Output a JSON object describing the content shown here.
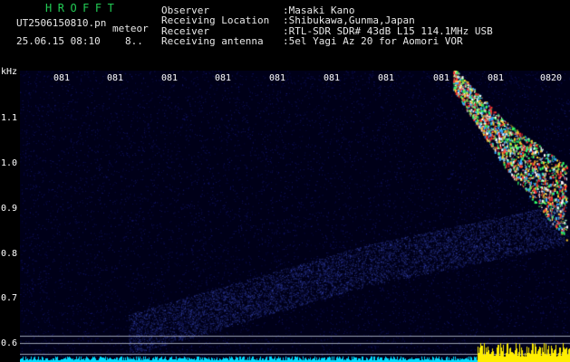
{
  "header": {
    "station_code": "HROFFT",
    "file_name": "UT2506150810.pn",
    "event_type": "meteor",
    "date_time": "25.06.15 08:10",
    "event_count": "8.."
  },
  "info": [
    {
      "key": "Observer",
      "value": ":Masaki Kano"
    },
    {
      "key": "Receiving Location",
      "value": ":Shibukawa,Gunma,Japan"
    },
    {
      "key": "Receiver",
      "value": ":RTL-SDR SDR# 43dB L15 114.1MHz USB"
    },
    {
      "key": "Receiving antenna",
      "value": ":5el Yagi Az 20 for Aomori VOR"
    }
  ],
  "spectrogram": {
    "y_unit": "kHz",
    "y_ticks": [
      "1.1",
      "1.0",
      "0.9",
      "0.8",
      "0.7",
      "0.6"
    ],
    "x_ticks": [
      "081",
      "081",
      "081",
      "081",
      "081",
      "081",
      "081",
      "081",
      "081",
      "0820"
    ],
    "colors": {
      "background": "#000018",
      "noise": "#2233aa",
      "echo_hot": "#ff3333",
      "echo_mid": "#33ff66",
      "echo_cool": "#33aaff",
      "baseline_level": "#00ddff",
      "signal_level": "#ffee00",
      "guide_line": "#9aa0b0"
    }
  }
}
